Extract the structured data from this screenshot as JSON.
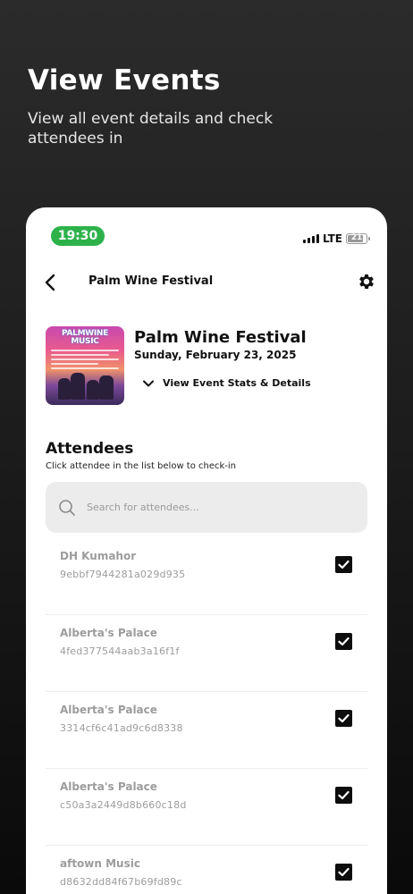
{
  "promo": {
    "title": "View Events",
    "subtitle": "View all event details and check attendees in"
  },
  "status_bar": {
    "time": "19:30",
    "network": "LTE",
    "battery": "21"
  },
  "header": {
    "title": "Palm Wine Festival",
    "back_icon": "chevron-left-icon",
    "settings_icon": "gear-icon"
  },
  "event": {
    "poster_text": "PALMWINE MUSIC",
    "name": "Palm Wine Festival",
    "date": "Sunday, February 23, 2025",
    "stats_toggle_label": "View Event Stats & Details"
  },
  "attendees": {
    "title": "Attendees",
    "subtitle": "Click attendee in the list below to check-in",
    "search_placeholder": "Search for attendees...",
    "items": [
      {
        "name": "DH Kumahor",
        "code": "9ebbf7944281a029d935",
        "checked": true
      },
      {
        "name": "Alberta's Palace",
        "code": "4fed377544aab3a16f1f",
        "checked": true
      },
      {
        "name": "Alberta's Palace",
        "code": "3314cf6c41ad9c6d8338",
        "checked": true
      },
      {
        "name": "Alberta's Palace",
        "code": "c50a3a2449d8b660c18d",
        "checked": true
      },
      {
        "name": "aftown Music",
        "code": "d8632dd84f67b69fd89c",
        "checked": true
      }
    ]
  },
  "colors": {
    "status_time_bg": "#2db24a",
    "checkbox": "#0d0d0d"
  }
}
